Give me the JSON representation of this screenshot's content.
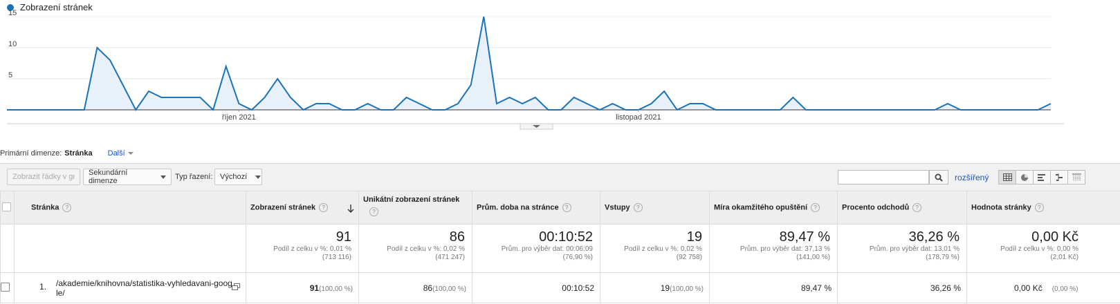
{
  "chart_data": {
    "type": "area",
    "legend": "Zobrazení stránek",
    "y_ticks": [
      "5",
      "10",
      "15"
    ],
    "ylim": [
      0,
      15
    ],
    "x_labels": [
      {
        "label": "říjen 2021",
        "index": 18
      },
      {
        "label": "listopad 2021",
        "index": 49
      }
    ],
    "series": [
      {
        "name": "Zobrazení stránek",
        "color": "#1a73b8",
        "values": [
          0,
          0,
          0,
          0,
          0,
          0,
          0,
          10,
          8,
          4,
          0,
          3,
          2,
          2,
          2,
          2,
          0,
          7,
          1,
          0,
          2,
          5,
          2,
          0,
          1,
          1,
          0,
          0,
          1,
          0,
          0,
          2,
          1,
          0,
          0,
          1,
          4,
          15,
          1,
          2,
          1,
          2,
          0,
          0,
          2,
          1,
          0,
          1,
          0,
          0,
          1,
          3,
          0,
          1,
          1,
          0,
          0,
          0,
          0,
          0,
          0,
          2,
          0,
          0,
          0,
          0,
          0,
          0,
          0,
          0,
          0,
          0,
          0,
          1,
          0,
          0,
          0,
          0,
          0,
          0,
          0,
          1
        ]
      }
    ]
  },
  "primary_dimension": {
    "label": "Primární dimenze:",
    "active": "Stránka",
    "more": "Další"
  },
  "toolbar": {
    "plot_rows": "Zobrazit řádky v grafu",
    "secondary_dim": "Sekundární dimenze",
    "sort_label": "Typ řazení:",
    "sort_value": "Výchozí",
    "advanced": "rozšířený"
  },
  "table": {
    "columns": [
      {
        "key": "page",
        "label": "Stránka"
      },
      {
        "key": "views",
        "label": "Zobrazení stránek"
      },
      {
        "key": "unique",
        "label": "Unikátní zobrazení stránek"
      },
      {
        "key": "avg_time",
        "label": "Prům. doba na stránce"
      },
      {
        "key": "entrances",
        "label": "Vstupy"
      },
      {
        "key": "bounce",
        "label": "Míra okamžitého opuštění"
      },
      {
        "key": "exit",
        "label": "Procento odchodů"
      },
      {
        "key": "value",
        "label": "Hodnota stránky"
      }
    ],
    "totals": {
      "views": {
        "value": "91",
        "l1": "Podíl z celku v %: 0,01 %",
        "l2": "(713 116)"
      },
      "unique": {
        "value": "86",
        "l1": "Podíl z celku v %: 0,02 %",
        "l2": "(471 247)"
      },
      "avg_time": {
        "value": "00:10:52",
        "l1": "Prům. pro výběr dat: 00:06:09",
        "l2": "(76,90 %)"
      },
      "entrances": {
        "value": "19",
        "l1": "Podíl z celku v %: 0,02 %",
        "l2": "(92 758)"
      },
      "bounce": {
        "value": "89,47 %",
        "l1": "Prům. pro výběr dat: 37,13 %",
        "l2": "(141,00 %)"
      },
      "exit": {
        "value": "36,26 %",
        "l1": "Prům. pro výběr dat: 13,01 %",
        "l2": "(178,79 %)"
      },
      "value": {
        "value": "0,00 Kč",
        "l1": "Podíl z celku v %: 0,00 %",
        "l2": "(2,01 Kč)"
      }
    },
    "rows": [
      {
        "num": "1.",
        "page": "/akademie/knihovna/statistika-vyhledavani-google/",
        "views": "91",
        "views_pct": "(100,00 %)",
        "unique": "86",
        "unique_pct": "(100,00 %)",
        "avg_time": "00:10:52",
        "entrances": "19",
        "entrances_pct": "(100,00 %)",
        "bounce": "89,47 %",
        "exit": "36,26 %",
        "value": "0,00 Kč",
        "value_pct": "(0,00 %)"
      }
    ]
  }
}
